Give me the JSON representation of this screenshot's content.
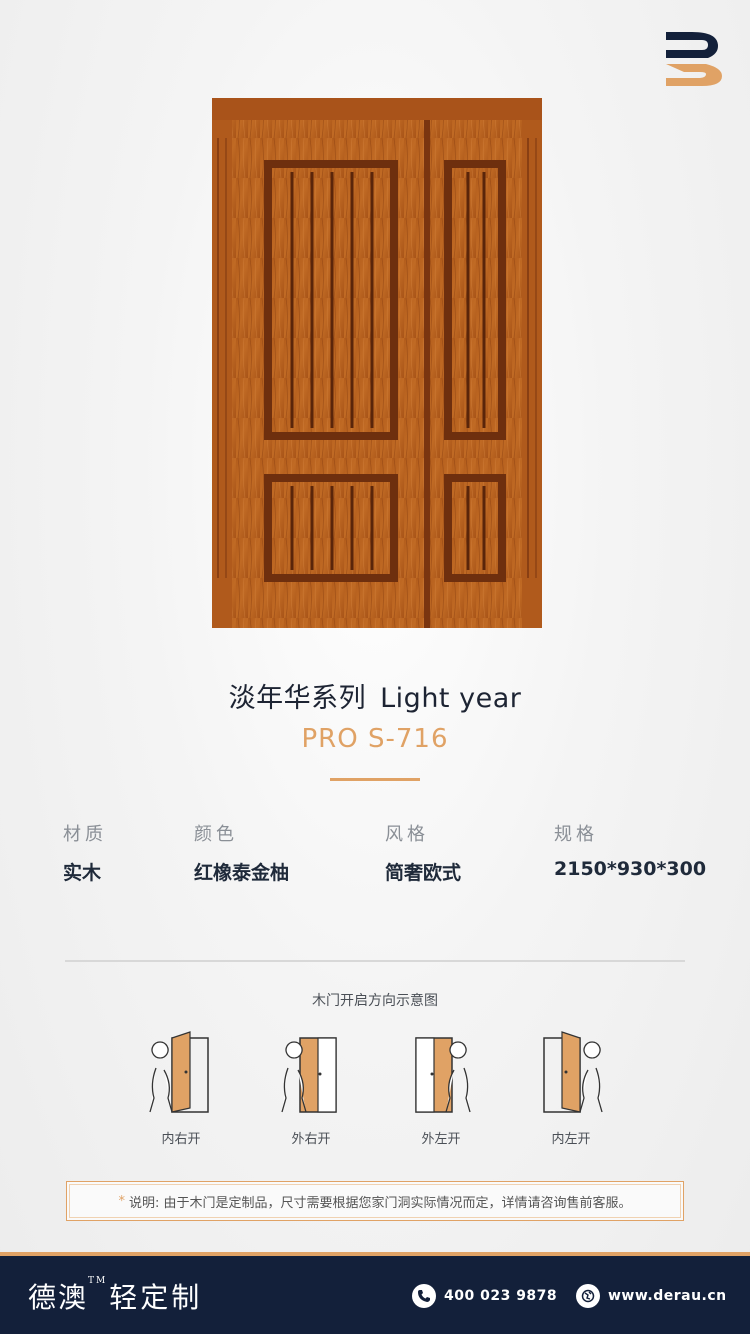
{
  "brand_logo": {
    "icon": "brand-b-logo-icon",
    "colors": {
      "navy": "#13203a",
      "gold": "#e0a265"
    }
  },
  "product_image": {
    "icon": "wooden-double-door"
  },
  "product": {
    "series_cn": "淡年华系列",
    "series_en": "Light year",
    "model": "PRO S-716"
  },
  "specs": [
    {
      "label": "材质",
      "value": "实木"
    },
    {
      "label": "颜色",
      "value": "红橡泰金柚"
    },
    {
      "label": "风格",
      "value": "简奢欧式"
    },
    {
      "label": "规格",
      "value": "2150*930*300"
    }
  ],
  "diagram": {
    "title": "木门开启方向示意图",
    "items": [
      {
        "label": "内右开",
        "icon": "inward-right-open-icon"
      },
      {
        "label": "外右开",
        "icon": "outward-right-open-icon"
      },
      {
        "label": "外左开",
        "icon": "outward-left-open-icon"
      },
      {
        "label": "内左开",
        "icon": "inward-left-open-icon"
      }
    ]
  },
  "note": {
    "star": "*",
    "text": "说明: 由于木门是定制品，尺寸需要根据您家门洞实际情况而定，详情请咨询售前客服。"
  },
  "footer": {
    "brand": "德澳",
    "tm": "TM",
    "brand_sub": "轻定制",
    "phone": "400 023 9878",
    "website": "www.derau.cn",
    "phone_icon": "phone-icon",
    "web_icon": "globe-icon"
  },
  "colors": {
    "accent": "#e0a265",
    "footer_bg": "#13203a",
    "text": "#1f2a3a"
  }
}
